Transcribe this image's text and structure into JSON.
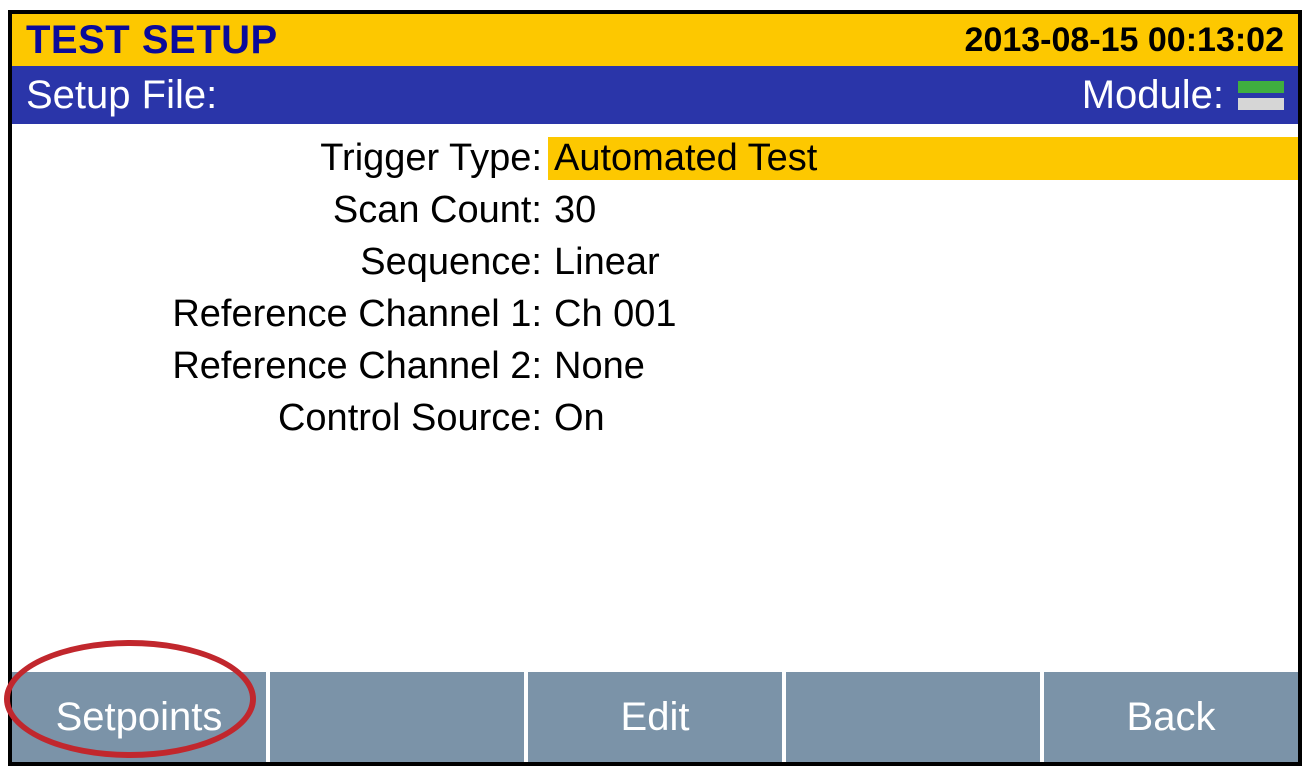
{
  "header": {
    "title": "TEST SETUP",
    "timestamp": "2013-08-15 00:13:02"
  },
  "subheader": {
    "setup_file_label": "Setup File:",
    "setup_file_value": "",
    "module_label": "Module:"
  },
  "fields": [
    {
      "label": "Trigger Type:",
      "value": "Automated Test",
      "selected": true
    },
    {
      "label": "Scan Count:",
      "value": "30",
      "selected": false
    },
    {
      "label": "Sequence:",
      "value": "Linear",
      "selected": false
    },
    {
      "label": "Reference Channel 1:",
      "value": "Ch 001",
      "selected": false
    },
    {
      "label": "Reference Channel 2:",
      "value": "None",
      "selected": false
    },
    {
      "label": "Control Source:",
      "value": "On",
      "selected": false
    }
  ],
  "softkeys": {
    "f1": "Setpoints",
    "f2": "",
    "f3": "Edit",
    "f4": "",
    "f5": "Back"
  }
}
